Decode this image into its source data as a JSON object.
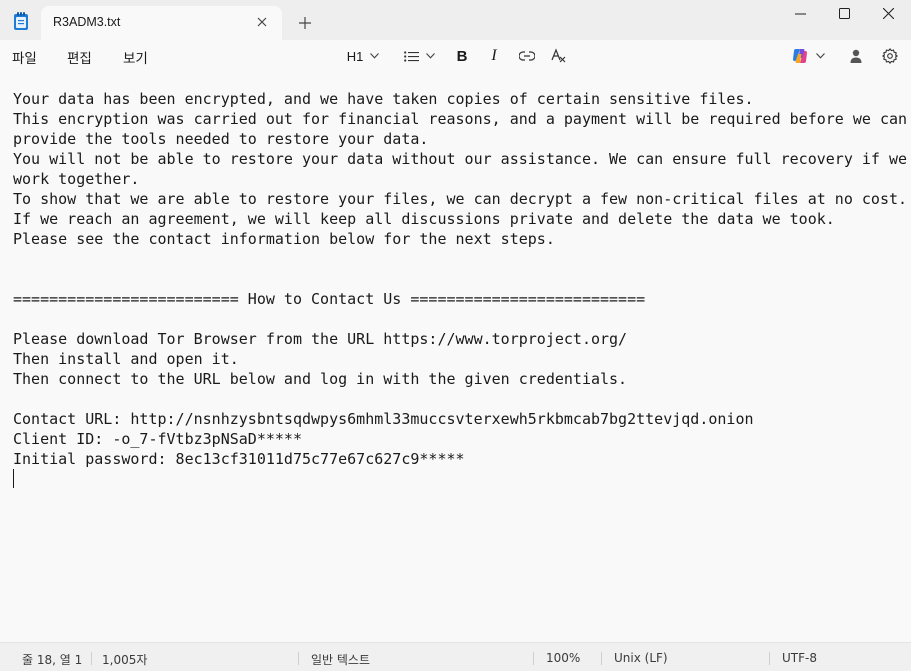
{
  "tab": {
    "title": "R3ADM3.txt"
  },
  "menu": [
    "파일",
    "편집",
    "보기"
  ],
  "toolbar": {
    "heading_label": "H1"
  },
  "document": {
    "lines": [
      "Your data has been encrypted, and we have taken copies of certain sensitive files.",
      "This encryption was carried out for financial reasons, and a payment will be required before we can",
      "provide the tools needed to restore your data.",
      "You will not be able to restore your data without our assistance. We can ensure full recovery if we",
      "work together.",
      "To show that we are able to restore your files, we can decrypt a few non-critical files at no cost.",
      "If we reach an agreement, we will keep all discussions private and delete the data we took.",
      "Please see the contact information below for the next steps.",
      "",
      "",
      "========================= How to Contact Us ==========================",
      "",
      "Please download Tor Browser from the URL https://www.torproject.org/",
      "Then install and open it.",
      "Then connect to the URL below and log in with the given credentials.",
      "",
      "Contact URL: http://nsnhzysbntsqdwpys6mhml33muccsvterxewh5rkbmcab7bg2ttevjqd.onion",
      "Client ID: -o_7-fVtbz3pNSaD*****",
      "Initial password: 8ec13cf31011d75c77e67c627c9*****"
    ]
  },
  "status": {
    "position": "줄 18, 열 1",
    "chars": "1,005자",
    "format": "일반 텍스트",
    "zoom": "100%",
    "line_ending": "Unix (LF)",
    "encoding": "UTF-8"
  },
  "colors": {
    "title_bar": "#eeeeee",
    "editor_bg": "#f9f9f9",
    "text": "#1a1a1a",
    "app_icon": "#1e7bd6"
  }
}
